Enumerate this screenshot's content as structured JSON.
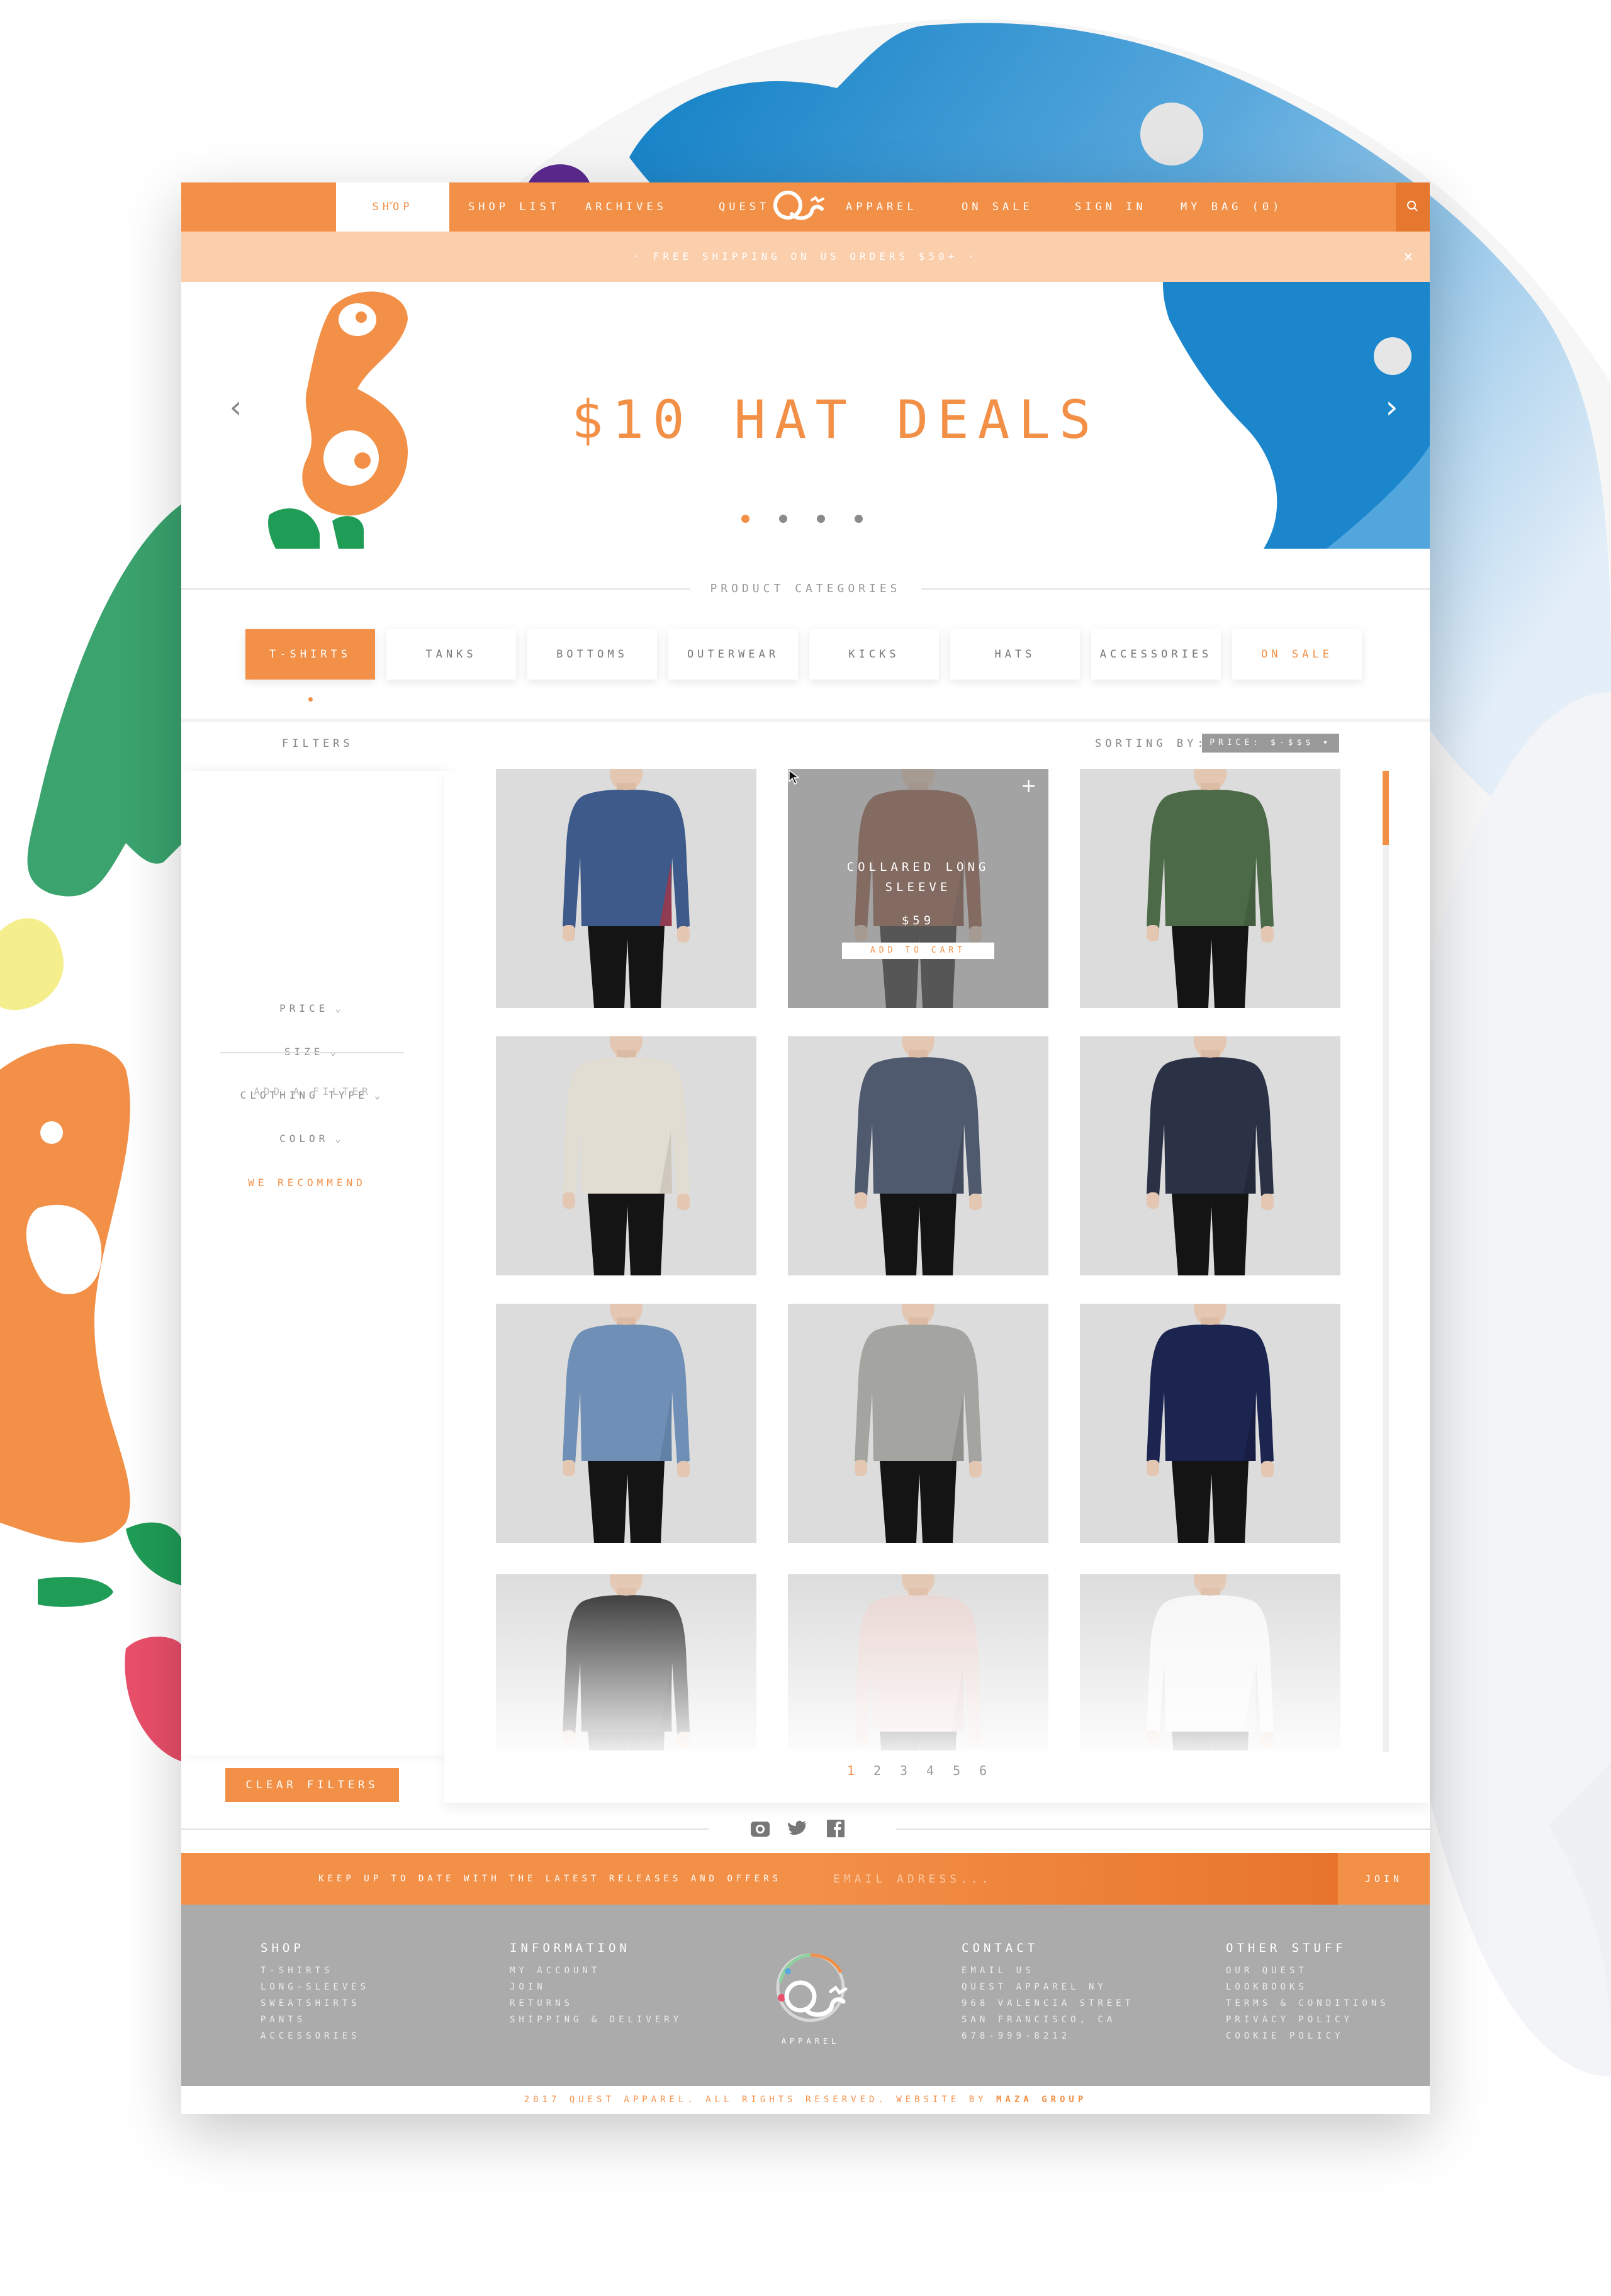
{
  "colors": {
    "accent": "#f39048",
    "promo_bar": "#fbceac",
    "footer_bg": "#ababab",
    "sort_bg": "#9a9a9a"
  },
  "nav": {
    "items": [
      "SHOP",
      "SHOP LIST",
      "ARCHIVES",
      "QUEST",
      "APPAREL",
      "ON SALE",
      "SIGN IN",
      "MY BAG (0)"
    ],
    "active_index": 0,
    "active_chevron": "chevron-down-icon",
    "search_icon": "search-icon",
    "logo_icon": "quest-logo-icon"
  },
  "promo": {
    "text": "· FREE SHIPPING ON US ORDERS $50+ ·",
    "close_icon": "close-icon",
    "close_glyph": "×"
  },
  "hero": {
    "title": "$10 HAT DEALS",
    "prev_glyph": "‹",
    "next_glyph": "›",
    "slide_count": 4,
    "active_slide": 0
  },
  "categories": {
    "title": "PRODUCT CATEGORIES",
    "items": [
      "T-SHIRTS",
      "TANKS",
      "BOTTOMS",
      "OUTERWEAR",
      "KICKS",
      "HATS",
      "ACCESSORIES",
      "ON SALE"
    ],
    "active_index": 0
  },
  "filters": {
    "title": "FILTERS",
    "items": [
      "PRICE",
      "SIZE",
      "CLOTHING TYPE",
      "COLOR"
    ],
    "chevron_glyph": "⌄",
    "recommend": "WE RECOMMEND",
    "add_filter": "ADD A FILTER",
    "clear_button": "CLEAR FILTERS"
  },
  "sorting": {
    "label": "SORTING BY:",
    "value": "PRICE: $-$$$ ▾"
  },
  "products": {
    "hover": {
      "plus": "+",
      "name": "COLLARED LONG SLEEVE",
      "price": "$59",
      "add_to_cart": "ADD TO CART"
    },
    "items": [
      {
        "style": "plaid-shirt",
        "colors": [
          "#3e5a8a",
          "#b3303c"
        ]
      },
      {
        "style": "collared-long-sleeve",
        "colors": [
          "#8a4a34",
          "#6a3626"
        ]
      },
      {
        "style": "hooded-jacket",
        "colors": [
          "#4c6a47",
          "#3e5a3a"
        ]
      },
      {
        "style": "knit-sweater",
        "colors": [
          "#e2ddd3",
          "#c7c1b4"
        ]
      },
      {
        "style": "knit-sweater",
        "colors": [
          "#4f5a6e",
          "#3c4556"
        ]
      },
      {
        "style": "check-shirt",
        "colors": [
          "#2c3246",
          "#1f2435"
        ]
      },
      {
        "style": "chambray-shirt",
        "colors": [
          "#6f8fb6",
          "#5b7aa0"
        ]
      },
      {
        "style": "striped-henley",
        "colors": [
          "#a4a4a0",
          "#888884"
        ]
      },
      {
        "style": "crew-sweatshirt",
        "colors": [
          "#1c2450",
          "#151b3d"
        ]
      },
      {
        "style": "black-tee",
        "colors": [
          "#2a2a2a",
          "#1e1e1e"
        ]
      },
      {
        "style": "pink-tee",
        "colors": [
          "#e7d3cf",
          "#d7bfba"
        ]
      },
      {
        "style": "photo-tee",
        "colors": [
          "#f6f6f6",
          "#e6e6e6"
        ]
      }
    ]
  },
  "pagination": {
    "pages": [
      "1",
      "2",
      "3",
      "4",
      "5",
      "6"
    ],
    "active": "1"
  },
  "social": [
    "instagram-icon",
    "twitter-icon",
    "facebook-icon"
  ],
  "newsletter": {
    "prompt": "KEEP UP TO DATE WITH THE LATEST RELEASES AND OFFERS",
    "placeholder": "EMAIL ADRESS...",
    "join": "JOIN"
  },
  "footer": {
    "shop": {
      "title": "SHOP",
      "links": [
        "T-SHIRTS",
        "LONG-SLEEVES",
        "SWEATSHIRTS",
        "PANTS",
        "ACCESSORIES"
      ]
    },
    "information": {
      "title": "INFORMATION",
      "links": [
        "MY ACCOUNT",
        "JOIN",
        "RETURNS",
        "SHIPPING & DELIVERY"
      ]
    },
    "contact": {
      "title": "CONTACT",
      "lines": [
        "EMAIL US",
        "QUEST APPAREL NY",
        "968 VALENCIA STREET",
        "SAN FRANCISCO, CA",
        "678-999-8212"
      ]
    },
    "other": {
      "title": "OTHER STUFF",
      "links": [
        "OUR QUEST",
        "LOOKBOOKS",
        "TERMS & CONDITIONS",
        "PRIVACY POLICY",
        "COOKIE POLICY"
      ]
    },
    "logo_text": "APPAREL"
  },
  "copyright": {
    "text": "2017 QUEST APPAREL. ALL RIGHTS RESERVED. WEBSITE BY ",
    "credit": "MAZA GROUP"
  }
}
